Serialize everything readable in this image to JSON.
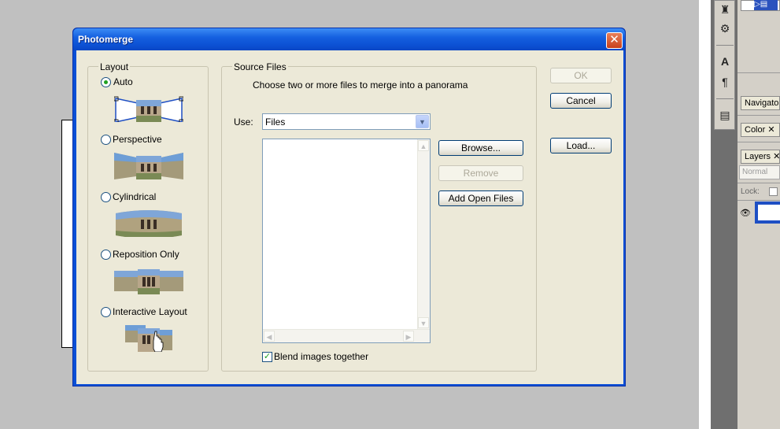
{
  "dialog": {
    "title": "Photomerge",
    "close_glyph": "✕"
  },
  "layout": {
    "legend": "Layout",
    "options": [
      {
        "label": "Auto",
        "selected": true
      },
      {
        "label": "Perspective",
        "selected": false
      },
      {
        "label": "Cylindrical",
        "selected": false
      },
      {
        "label": "Reposition Only",
        "selected": false
      },
      {
        "label": "Interactive Layout",
        "selected": false
      }
    ]
  },
  "source": {
    "legend": "Source Files",
    "instruction": "Choose two or more files to merge into a panorama",
    "use_label": "Use:",
    "use_value": "Files",
    "browse_label": "Browse...",
    "remove_label": "Remove",
    "add_open_label": "Add Open Files",
    "blend_label": "Blend images together",
    "blend_checked": true,
    "files": []
  },
  "buttons": {
    "ok_label": "OK",
    "cancel_label": "Cancel",
    "load_label": "Load..."
  },
  "ps_panels": {
    "navigator_tab": "Navigator",
    "color_tab": "Color",
    "layers_tab": "Layers",
    "blend_mode": "Normal",
    "lock_label": "Lock:"
  },
  "colors": {
    "title_blue": "#0b4fd2",
    "dialog_bg": "#ece9d8",
    "radio_dot": "#21a121"
  }
}
